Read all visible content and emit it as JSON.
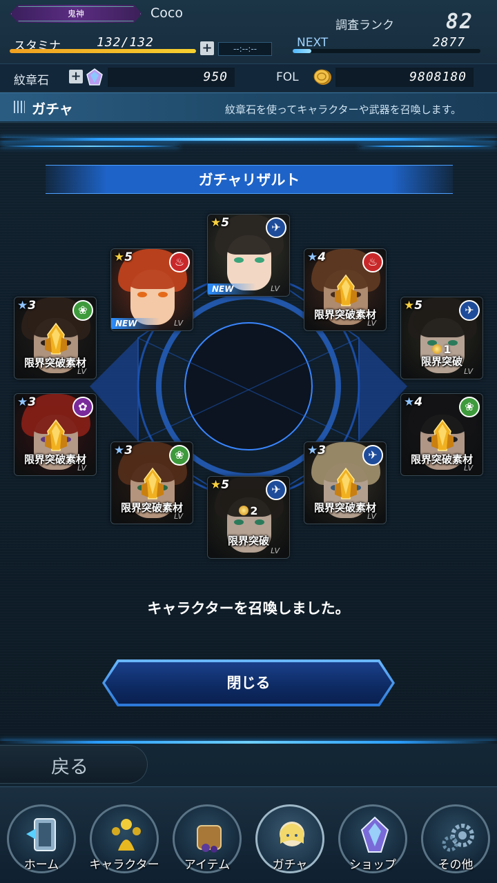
{
  "header": {
    "title_badge": "鬼神",
    "username": "Coco",
    "rank_label": "調査ランク",
    "rank_value": "82",
    "stamina_label": "スタミナ",
    "stamina_value": "132/132",
    "stamina_fill": 1.0,
    "timer": "--:--:--",
    "next_label": "NEXT",
    "next_value": "2877",
    "next_fill": 0.1,
    "gem_label": "紋章石",
    "gem_value": "950",
    "fol_label": "FOL",
    "fol_value": "9808180"
  },
  "section": {
    "title": "ガチャ",
    "description": "紋章石を使ってキャラクターや武器を召喚します。"
  },
  "result": {
    "banner": "ガチャリザルト",
    "message": "キャラクターを召喚しました。",
    "close_label": "閉じる",
    "cards": [
      {
        "rarity": "5",
        "element": "fire",
        "element_icon": "fire-element-icon",
        "new_label": "NEW",
        "lv": "LV",
        "tag": "",
        "count": "",
        "hair": "#b8401c",
        "skin": "#f3c9a7",
        "eye": "#e46a1a",
        "bg": "#6b2a18"
      },
      {
        "rarity": "5",
        "element": "slash",
        "element_icon": "slash-element-icon",
        "new_label": "NEW",
        "lv": "LV",
        "tag": "",
        "count": "",
        "hair": "#2a2622",
        "skin": "#f2d8c4",
        "eye": "#3aa57a",
        "bg": "#3a3a2a"
      },
      {
        "rarity": "4",
        "element": "fire",
        "element_icon": "fire-element-icon",
        "new_label": "",
        "lv": "LV",
        "tag": "限界突破素材",
        "count": "",
        "hair": "#7a4a2c",
        "skin": "#e8b894",
        "eye": "#5a3a2a",
        "bg": "#5a3526"
      },
      {
        "rarity": "3",
        "element": "wind",
        "element_icon": "wind-element-icon",
        "new_label": "",
        "lv": "LV",
        "tag": "限界突破素材",
        "count": "",
        "hair": "#3a2a22",
        "skin": "#e9c4a8",
        "eye": "#3a2a22",
        "bg": "#2e2824"
      },
      {
        "rarity": "5",
        "element": "slash",
        "element_icon": "slash-element-icon",
        "new_label": "",
        "lv": "LV",
        "tag": "限界突破",
        "count": "1",
        "hair": "#2a2622",
        "skin": "#f2d8c4",
        "eye": "#3aa57a",
        "bg": "#3a3a2a"
      },
      {
        "rarity": "3",
        "element": "dark",
        "element_icon": "dark-element-icon",
        "new_label": "",
        "lv": "LV",
        "tag": "限界突破素材",
        "count": "",
        "hair": "#a8281e",
        "skin": "#f0cdb4",
        "eye": "#7a4ab4",
        "bg": "#4a1a1a"
      },
      {
        "rarity": "4",
        "element": "wind",
        "element_icon": "wind-element-icon",
        "new_label": "",
        "lv": "LV",
        "tag": "限界突破素材",
        "count": "",
        "hair": "#1a1a1e",
        "skin": "#eac9b2",
        "eye": "#2a2a2e",
        "bg": "#1e1e22"
      },
      {
        "rarity": "3",
        "element": "wind",
        "element_icon": "wind-element-icon",
        "new_label": "",
        "lv": "LV",
        "tag": "限界突破素材",
        "count": "",
        "hair": "#6a3a22",
        "skin": "#f0c6a6",
        "eye": "#3a8a5a",
        "bg": "#3a261c"
      },
      {
        "rarity": "3",
        "element": "slash",
        "element_icon": "slash-element-icon",
        "new_label": "",
        "lv": "LV",
        "tag": "限界突破素材",
        "count": "",
        "hair": "#c9b48a",
        "skin": "#efd4be",
        "eye": "#4a7aa8",
        "bg": "#4a4234"
      },
      {
        "rarity": "5",
        "element": "slash",
        "element_icon": "slash-element-icon",
        "new_label": "",
        "lv": "LV",
        "tag": "限界突破",
        "count": "2",
        "hair": "#2a2622",
        "skin": "#f2d8c4",
        "eye": "#3aa57a",
        "bg": "#3a3a2a"
      }
    ]
  },
  "footer": {
    "back_label": "戻る",
    "nav": [
      {
        "label": "ホーム",
        "icon": "home-icon",
        "active": false
      },
      {
        "label": "キャラクター",
        "icon": "character-icon",
        "active": false
      },
      {
        "label": "アイテム",
        "icon": "item-bag-icon",
        "active": false
      },
      {
        "label": "ガチャ",
        "icon": "gacha-icon",
        "active": true
      },
      {
        "label": "ショップ",
        "icon": "shop-crystal-icon",
        "active": false
      },
      {
        "label": "その他",
        "icon": "settings-gear-icon",
        "active": false
      }
    ]
  }
}
